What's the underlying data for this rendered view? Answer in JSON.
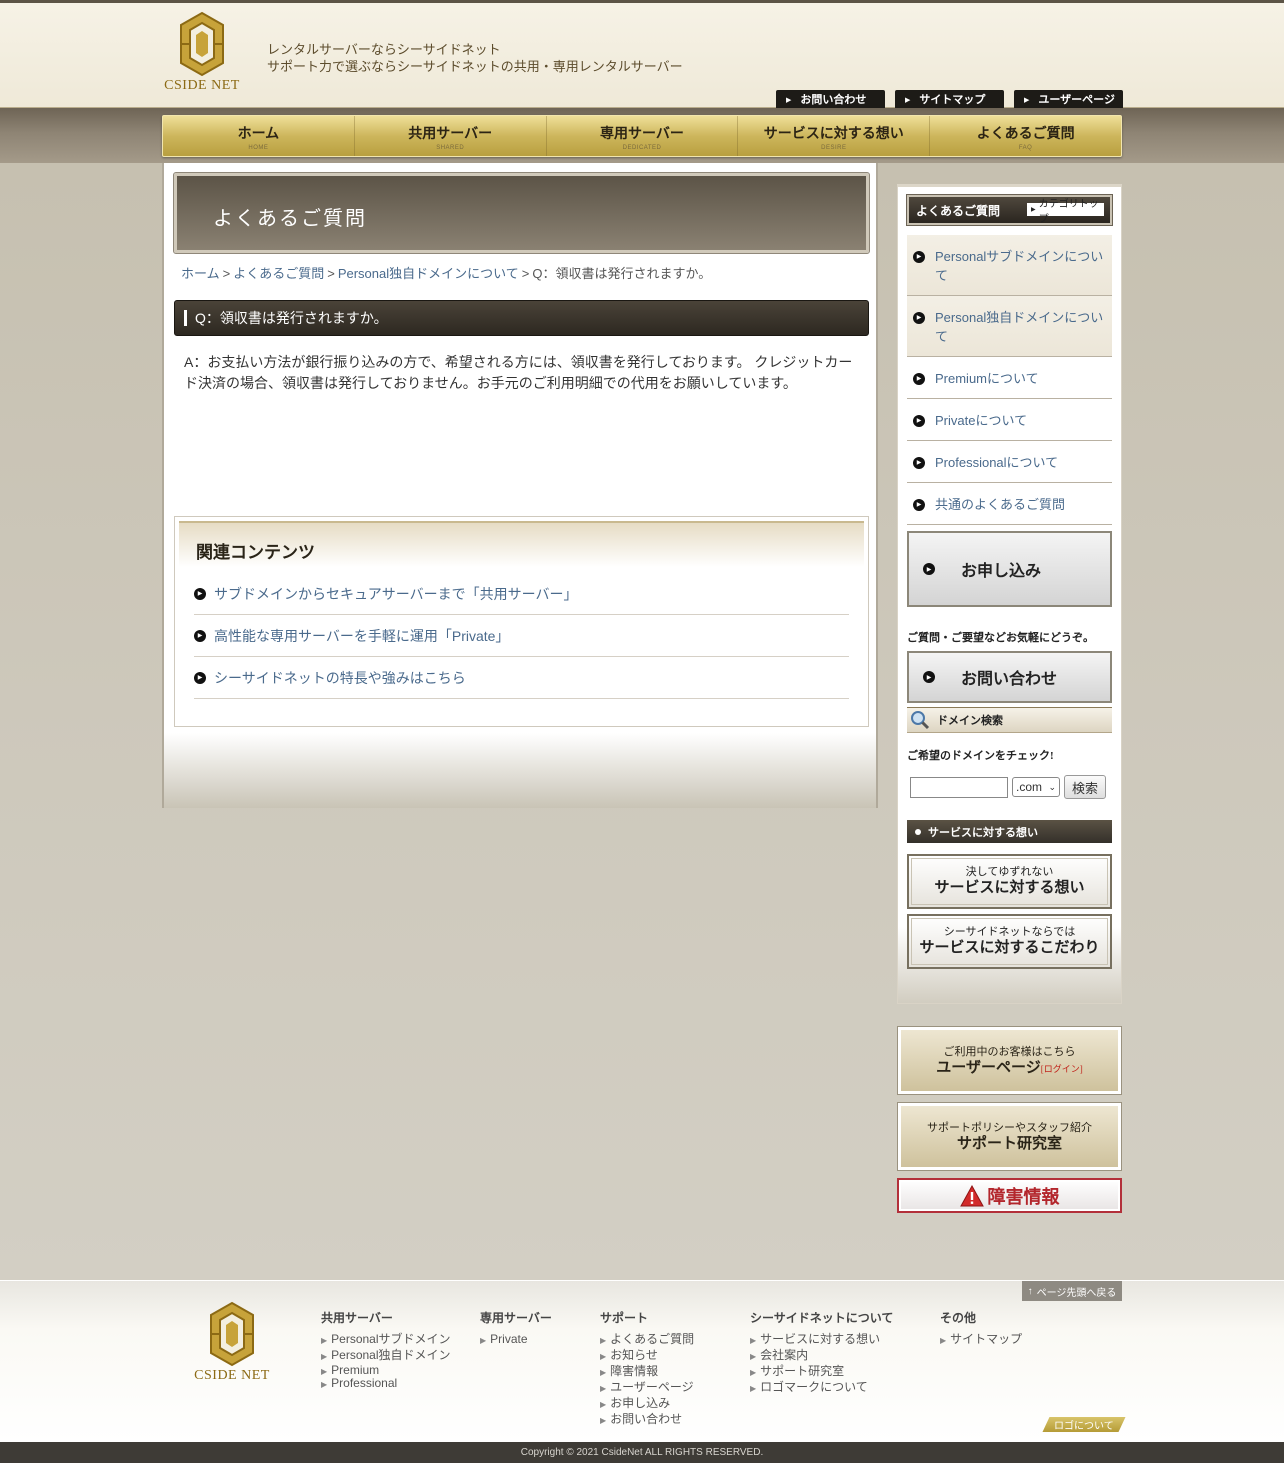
{
  "site": {
    "logo_text": "CSIDE NET",
    "tagline_1": "レンタルサーバーならシーサイドネット",
    "tagline_2": "サポート力で選ぶならシーサイドネットの共用・専用レンタルサーバー"
  },
  "util_nav": [
    {
      "label": "お問い合わせ"
    },
    {
      "label": "サイトマップ"
    },
    {
      "label": "ユーザーページ"
    }
  ],
  "global_nav": [
    {
      "label": "ホーム",
      "sub": "HOME"
    },
    {
      "label": "共用サーバー",
      "sub": "SHARED"
    },
    {
      "label": "専用サーバー",
      "sub": "DEDICATED"
    },
    {
      "label": "サービスに対する想い",
      "sub": "DESIRE"
    },
    {
      "label": "よくあるご質問",
      "sub": "FAQ"
    }
  ],
  "page": {
    "title": "よくあるご質問",
    "breadcrumb": [
      {
        "label": "ホーム"
      },
      {
        "label": "よくあるご質問"
      },
      {
        "label": "Personal独自ドメインについて"
      },
      {
        "label": "Q：領収書は発行されますか。"
      }
    ],
    "breadcrumb_sep": ">",
    "question": "Q：領収書は発行されますか。",
    "answer": "A：お支払い方法が銀行振り込みの方で、希望される方には、領収書を発行しております。 クレジットカード決済の場合、領収書は発行しておりません。お手元のご利用明細での代用をお願いしています。"
  },
  "related": {
    "title": "関連コンテンツ",
    "items": [
      {
        "label": "サブドメインからセキュアサーバーまで「共用サーバー」"
      },
      {
        "label": "高性能な専用サーバーを手軽に運用「Private」"
      },
      {
        "label": "シーサイドネットの特長や強みはこちら"
      }
    ]
  },
  "sidebar": {
    "faq_title": "よくあるご質問",
    "category_top": "カテゴリトップ",
    "categories": [
      {
        "label": "Personalサブドメインについて"
      },
      {
        "label": "Personal独自ドメインについて"
      },
      {
        "label": "Premiumについて"
      },
      {
        "label": "Privateについて"
      },
      {
        "label": "Professionalについて"
      },
      {
        "label": "共通のよくあるご質問"
      }
    ],
    "apply_label": "お申し込み",
    "contact_note": "ご質問・ご要望などお気軽にどうぞ。",
    "contact_label": "お問い合わせ",
    "domain_title": "ドメイン検索",
    "domain_note": "ご希望のドメインをチェック!",
    "domain_input_value": "",
    "domain_tld": ".com",
    "domain_submit": "検索",
    "service_title": "サービスに対する想い",
    "service_banners": [
      {
        "small": "決してゆずれない",
        "large": "サービスに対する想い"
      },
      {
        "small": "シーサイドネットならでは",
        "large": "サービスに対するこだわり"
      }
    ],
    "user_banner": {
      "small": "ご利用中のお客様はこちら",
      "large": "ユーザーページ",
      "tag": "[ログイン]"
    },
    "support_banner": {
      "small": "サポートポリシーやスタッフ紹介",
      "large": "サポート研究室"
    },
    "alert_banner": "障害情報"
  },
  "footer": {
    "page_top": "ページ先頭へ戻る",
    "columns": [
      {
        "title": "共用サーバー",
        "items": [
          "Personalサブドメイン",
          "Personal独自ドメイン",
          "Premium",
          "Professional"
        ]
      },
      {
        "title": "専用サーバー",
        "items": [
          "Private"
        ]
      },
      {
        "title": "サポート",
        "items": [
          "よくあるご質問",
          "お知らせ",
          "障害情報",
          "ユーザーページ",
          "お申し込み",
          "お問い合わせ"
        ]
      },
      {
        "title": "シーサイドネットについて",
        "items": [
          "サービスに対する想い",
          "会社案内",
          "サポート研究室",
          "ロゴマークについて"
        ]
      },
      {
        "title": "その他",
        "items": [
          "サイトマップ"
        ]
      }
    ],
    "logo_about": "ロゴについて",
    "copyright": "Copyright © 2021 CsideNet ALL RIGHTS RESERVED."
  },
  "colors": {
    "gold": "#c8a83c",
    "dark_bar": "#2d2821",
    "link": "#4a6a8c",
    "alert": "#b3262c"
  }
}
